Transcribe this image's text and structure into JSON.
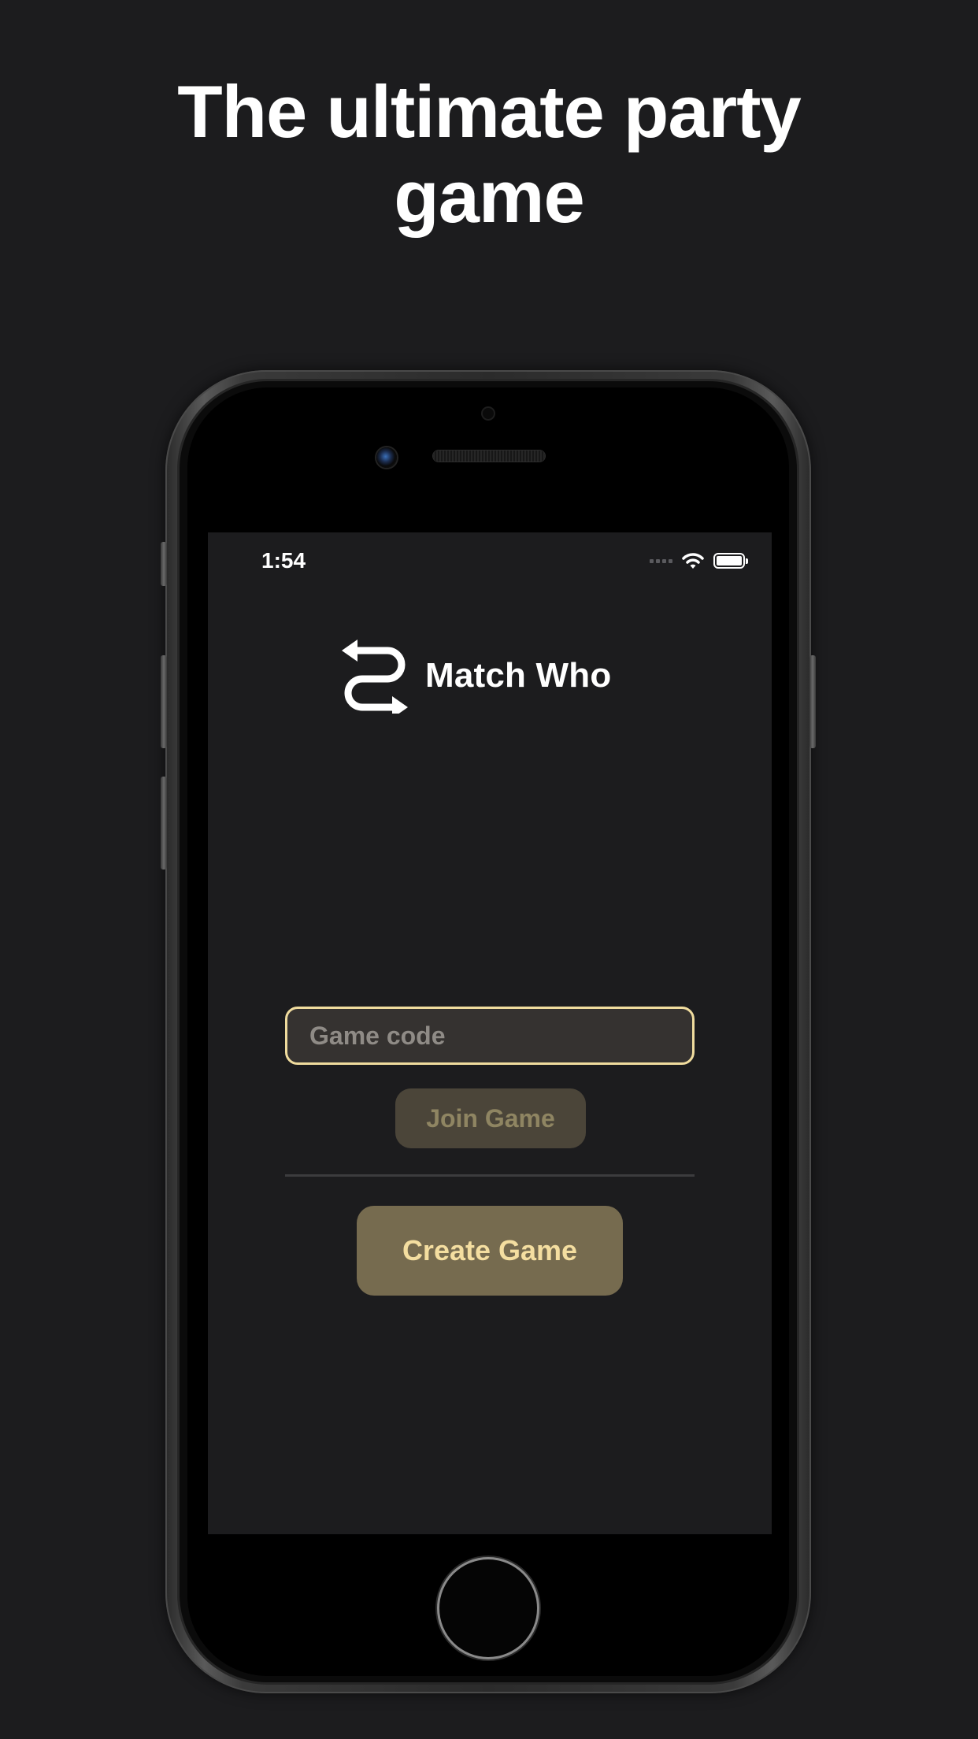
{
  "headline": {
    "line1": "The ultimate party",
    "line2": "game"
  },
  "status_bar": {
    "time": "1:54",
    "icons": [
      "signal-icon",
      "wifi-icon",
      "battery-icon"
    ]
  },
  "app": {
    "title": "Match Who",
    "logo_icon": "swap-arrows-icon"
  },
  "form": {
    "code_placeholder": "Game code",
    "code_value": "",
    "join_label": "Join Game",
    "create_label": "Create Game"
  },
  "colors": {
    "background": "#1c1c1e",
    "input_border": "#f0dc9e",
    "join_button_bg": "#4b4539",
    "join_button_text": "#8f8562",
    "create_button_bg": "#766b4f",
    "create_button_text": "#f4dea0"
  }
}
